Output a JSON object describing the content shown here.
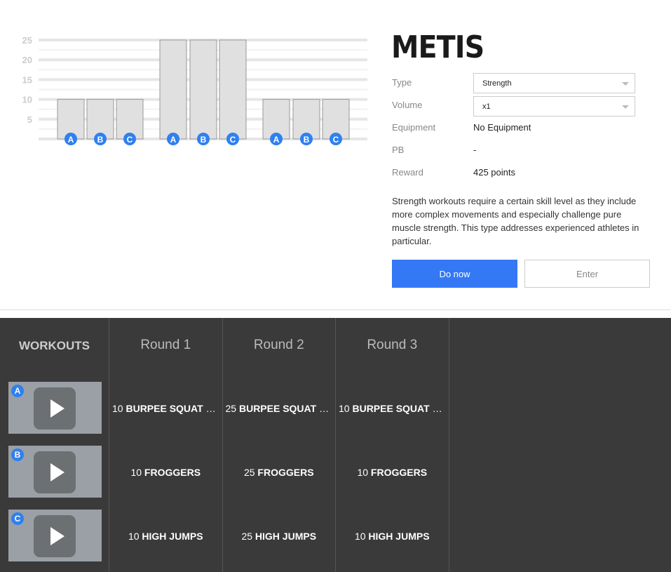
{
  "chart_data": {
    "type": "bar",
    "yticks": [
      5,
      10,
      15,
      20,
      25
    ],
    "ylim": [
      0,
      25
    ],
    "grid": true,
    "categories": [
      "A",
      "B",
      "C",
      "A",
      "B",
      "C",
      "A",
      "B",
      "C"
    ],
    "values": [
      10,
      10,
      10,
      25,
      25,
      25,
      10,
      10,
      10
    ],
    "badge_color": "#2f80f0"
  },
  "title": "METIS",
  "details": [
    {
      "label": "Type",
      "value": "Strength",
      "kind": "select"
    },
    {
      "label": "Volume",
      "value": "x1",
      "kind": "select"
    },
    {
      "label": "Equipment",
      "value": "No Equipment"
    },
    {
      "label": "PB",
      "value": "-"
    },
    {
      "label": "Reward",
      "value": "425 points"
    }
  ],
  "description": "Strength workouts require a certain skill level as they include more complex movements and especially challenge pure muscle strength. This type addresses experienced athletes in particular.",
  "buttons": {
    "primary": "Do now",
    "secondary": "Enter"
  },
  "accent": "#3478f6",
  "table": {
    "workouts_header": "WORKOUTS",
    "rounds": [
      "Round 1",
      "Round 2",
      "Round 3"
    ],
    "workouts": [
      {
        "badge": "A",
        "reps": [
          "10",
          "25",
          "10"
        ],
        "name": "BURPEE SQUAT JUMPS"
      },
      {
        "badge": "B",
        "reps": [
          "10",
          "25",
          "10"
        ],
        "name": "FROGGERS"
      },
      {
        "badge": "C",
        "reps": [
          "10",
          "25",
          "10"
        ],
        "name": "HIGH JUMPS"
      }
    ]
  }
}
